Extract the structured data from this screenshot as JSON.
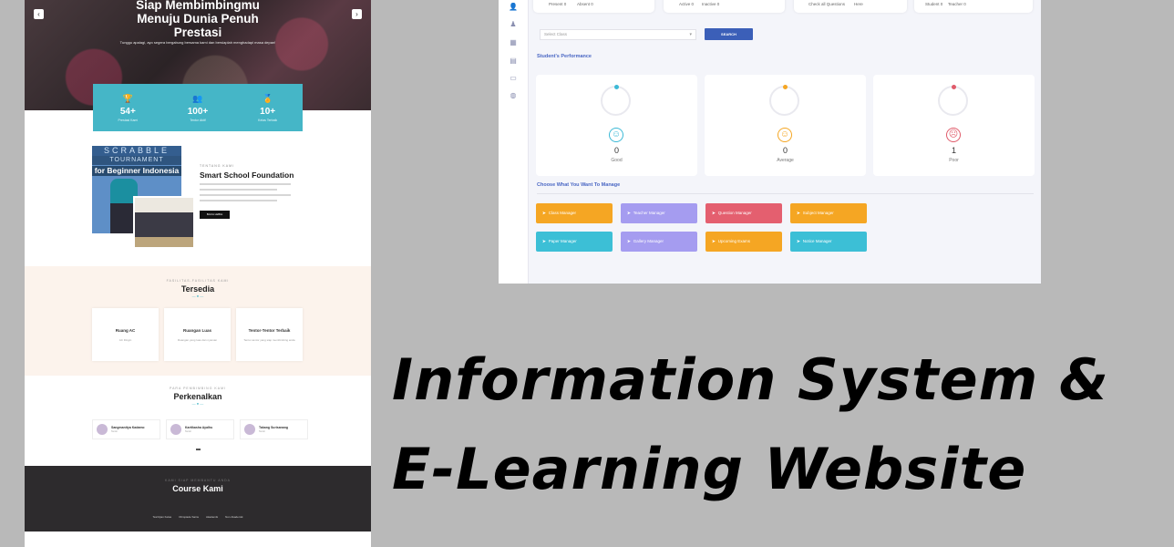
{
  "landing": {
    "hero": {
      "title_line1": "Siap Membimbingmu",
      "title_line2": "Menuju Dunia Penuh",
      "title_line3": "Prestasi",
      "subtitle": "Tunggu apalagi, ayo segera bergabung bersama kami dan bersiaplah menghadapi masa depan!"
    },
    "stats": [
      {
        "icon": "trophy-icon",
        "value": "54+",
        "label": "Prestasi Kami"
      },
      {
        "icon": "users-icon",
        "value": "100+",
        "label": "Tentor Aktif"
      },
      {
        "icon": "award-icon",
        "value": "10+",
        "label": "Kelas Terbaik"
      }
    ],
    "about": {
      "img_line1": "SCRABBLE",
      "img_line2": "TOURNAMENT",
      "img_line3": "for Beginner Indonesia",
      "eyebrow": "TENTANG KAMI",
      "title": "Smart School Foundation",
      "button": "BACA LEBIH"
    },
    "facilities": {
      "eyebrow": "FASILITAS-FASILITAS KAMI",
      "title": "Tersedia",
      "cards": [
        {
          "title": "Ruang AC",
          "desc": "AC Dingin"
        },
        {
          "title": "Ruangan Luas",
          "desc": "Ruangan yang luas dan nyaman"
        },
        {
          "title": "Tentor-Tentor Terbaik",
          "desc": "Tentor-tentor yang siap membimbing anda"
        }
      ]
    },
    "mentors": {
      "eyebrow": "PARA PEMBIMBING KAMI",
      "title": "Perkenalkan",
      "items": [
        {
          "name": "Sangmanitya Kadamo",
          "role": "Tentor"
        },
        {
          "name": "Kartikasha Ayalhu",
          "role": "Tentor"
        },
        {
          "name": "Takang Surisanang",
          "role": "Tentor"
        }
      ]
    },
    "courses": {
      "eyebrow": "KAMI SIAP MEMBANTU ANDA",
      "title": "Course Kami",
      "tabs": [
        "Tes/Ujian Kelas",
        "Olimpiade Sains",
        "Akademik",
        "Non Akademik"
      ]
    }
  },
  "dashboard": {
    "top_stats": [
      {
        "a": "Present 0",
        "b": "Absent 0"
      },
      {
        "a": "Active 0",
        "b": "Inactive 0"
      },
      {
        "a": "Check all Questions",
        "b": "Here"
      },
      {
        "a": "Student 0",
        "b": "Teacher 0"
      }
    ],
    "select_placeholder": "Select Class",
    "search_label": "SEARCH",
    "performance_title": "Student's Performance",
    "performance": [
      {
        "value": "0",
        "label": "Good",
        "color": "#3cb9d6"
      },
      {
        "value": "0",
        "label": "Average",
        "color": "#f5a623"
      },
      {
        "value": "1",
        "label": "Poor",
        "color": "#e05b6a"
      }
    ],
    "manage_title": "Choose What You Want To Manage",
    "manage_buttons": [
      {
        "label": "Class Manager",
        "color": "#f5a623"
      },
      {
        "label": "Teacher Manager",
        "color": "#a59cf0"
      },
      {
        "label": "Question Manager",
        "color": "#e45f6f"
      },
      {
        "label": "Subject Manager",
        "color": "#f5a623"
      },
      {
        "label": "Paper Manager",
        "color": "#3cbfd6"
      },
      {
        "label": "Gallery Manager",
        "color": "#a59cf0"
      },
      {
        "label": "Upcoming Exams",
        "color": "#f5a623"
      },
      {
        "label": "Notice Manager",
        "color": "#3cbfd6"
      }
    ]
  },
  "caption": {
    "line1": "Information System &",
    "line2": "E-Learning Website"
  }
}
